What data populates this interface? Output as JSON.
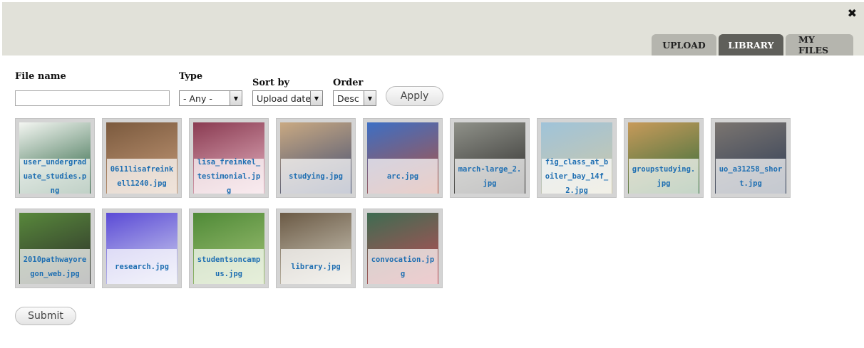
{
  "header": {
    "tabs": [
      {
        "label": "UPLOAD",
        "active": false
      },
      {
        "label": "LIBRARY",
        "active": true
      },
      {
        "label": "MY FILES",
        "active": false
      }
    ]
  },
  "filters": {
    "file_name_label": "File name",
    "file_name_value": "",
    "type_label": "Type",
    "type_value": "- Any -",
    "sort_label": "Sort by",
    "sort_value": "Upload date",
    "order_label": "Order",
    "order_value": "Desc",
    "apply_label": "Apply"
  },
  "files": [
    {
      "name": "user_undergraduate_studies.png",
      "colors": [
        "#f4f6f2",
        "#1f5a36"
      ]
    },
    {
      "name": "0611lisafreinkell1240.jpg",
      "colors": [
        "#7b5a3e",
        "#c79c7a"
      ]
    },
    {
      "name": "lisa_freinkel_testimonial.jpg",
      "colors": [
        "#8a3b52",
        "#e9b7c5"
      ]
    },
    {
      "name": "studying.jpg",
      "colors": [
        "#c9a982",
        "#3e4c73"
      ]
    },
    {
      "name": "arc.jpg",
      "colors": [
        "#3d6fc4",
        "#b4523d"
      ]
    },
    {
      "name": "march-large_2.jpg",
      "colors": [
        "#8f9189",
        "#2c2b2a"
      ]
    },
    {
      "name": "fig_class_at_boiler_bay_14f_2.jpg",
      "colors": [
        "#9fc3d9",
        "#cfc8a8"
      ]
    },
    {
      "name": "groupstudying.jpg",
      "colors": [
        "#c79a5a",
        "#2e6b3a"
      ]
    },
    {
      "name": "uo_a31258_short.jpg",
      "colors": [
        "#7b7570",
        "#2d3b55"
      ]
    },
    {
      "name": "2010pathwayoregon_web.jpg",
      "colors": [
        "#58883b",
        "#2a2a2a"
      ]
    },
    {
      "name": "research.jpg",
      "colors": [
        "#5a4ad6",
        "#d5d8ef"
      ]
    },
    {
      "name": "studentsoncampus.jpg",
      "colors": [
        "#4f8a37",
        "#a6c57a"
      ]
    },
    {
      "name": "library.jpg",
      "colors": [
        "#6b5a45",
        "#d4d0c2"
      ]
    },
    {
      "name": "convocation.jpg",
      "colors": [
        "#3e6c52",
        "#c44a55"
      ]
    }
  ],
  "submit_label": "Submit"
}
